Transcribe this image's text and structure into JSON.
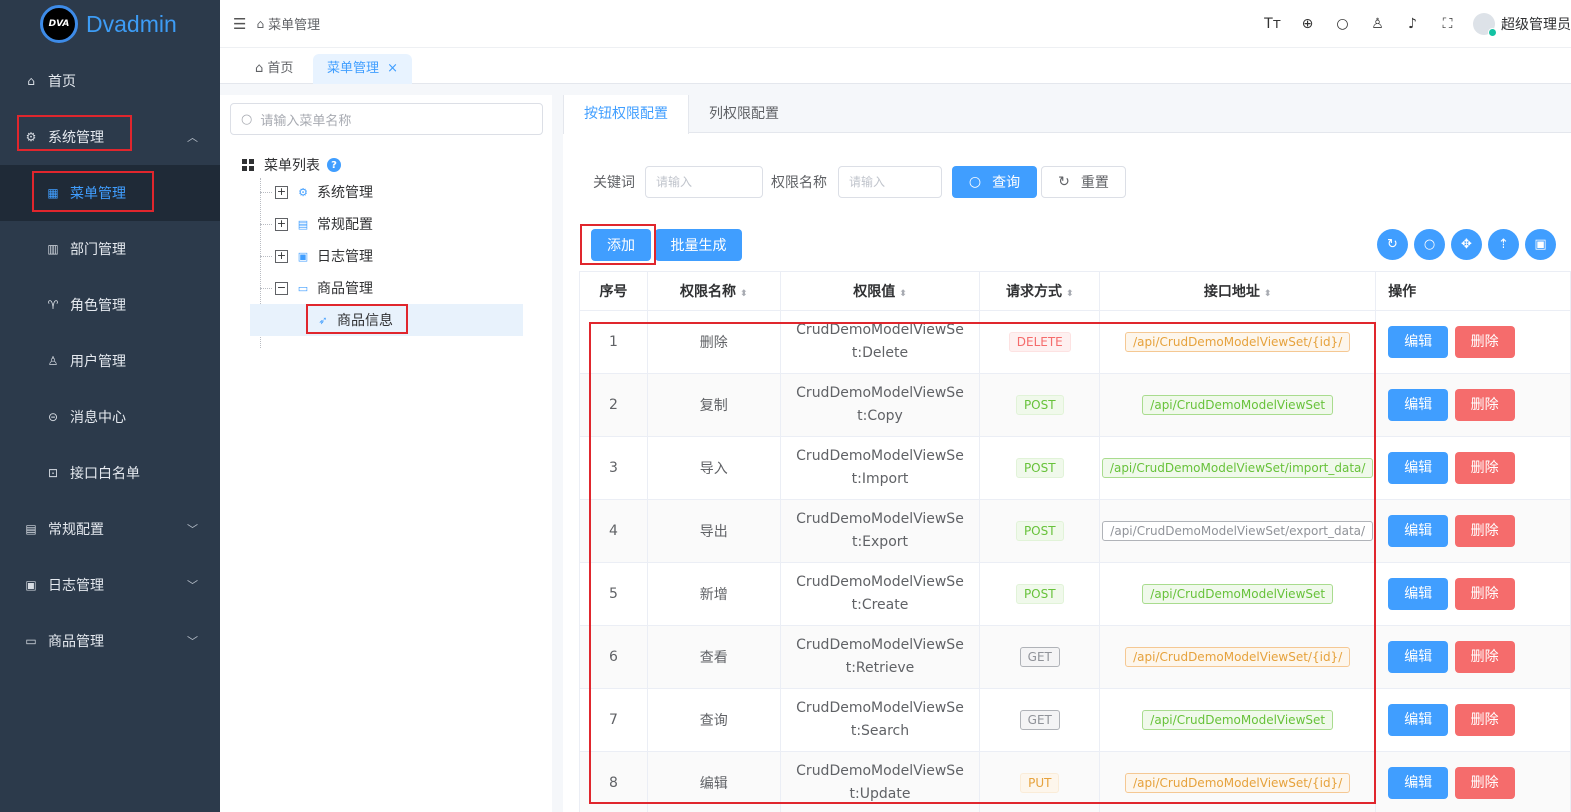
{
  "app": {
    "logo_badge": "DVA",
    "name": "Dvadmin"
  },
  "sidebar": {
    "items": [
      {
        "label": "首页",
        "icon": "home-icon"
      },
      {
        "label": "系统管理",
        "icon": "gear-icon",
        "expanded": true
      },
      {
        "label": "菜单管理",
        "icon": "grid-icon",
        "active": true
      },
      {
        "label": "部门管理",
        "icon": "building-icon"
      },
      {
        "label": "角色管理",
        "icon": "role-icon"
      },
      {
        "label": "用户管理",
        "icon": "user-icon"
      },
      {
        "label": "消息中心",
        "icon": "message-icon"
      },
      {
        "label": "接口白名单",
        "icon": "whitelist-icon"
      },
      {
        "label": "常规配置",
        "icon": "config-icon"
      },
      {
        "label": "日志管理",
        "icon": "log-icon"
      },
      {
        "label": "商品管理",
        "icon": "goods-icon"
      }
    ]
  },
  "header": {
    "breadcrumb": "菜单管理",
    "user": "超级管理员"
  },
  "tabs": [
    {
      "label": "首页"
    },
    {
      "label": "菜单管理"
    }
  ],
  "tree": {
    "search_placeholder": "请输入菜单名称",
    "root": "菜单列表",
    "help": "?",
    "nodes": [
      {
        "label": "系统管理",
        "state": "+"
      },
      {
        "label": "常规配置",
        "state": "+"
      },
      {
        "label": "日志管理",
        "state": "+"
      },
      {
        "label": "商品管理",
        "state": "−"
      }
    ],
    "leaf": "商品信息"
  },
  "panel": {
    "tabs": [
      {
        "label": "按钮权限配置"
      },
      {
        "label": "列权限配置"
      }
    ],
    "filter": {
      "keyword_label": "关键词",
      "keyword_placeholder": "请输入",
      "name_label": "权限名称",
      "name_placeholder": "请输入",
      "query": "查询",
      "reset": "重置"
    },
    "add": "添加",
    "batch": "批量生成"
  },
  "table": {
    "headers": {
      "no": "序号",
      "name": "权限名称",
      "value": "权限值",
      "method": "请求方式",
      "api": "接口地址",
      "ops": "操作"
    },
    "edit": "编辑",
    "delete": "删除",
    "rows": [
      {
        "no": "1",
        "name": "删除",
        "value": "CrudDemoModelViewSet:Delete",
        "method": "DELETE",
        "method_style": "danger",
        "api": "/api/CrudDemoModelViewSet/{id}/",
        "api_style": "warning"
      },
      {
        "no": "2",
        "name": "复制",
        "value": "CrudDemoModelViewSet:Copy",
        "method": "POST",
        "method_style": "success",
        "api": "/api/CrudDemoModelViewSet",
        "api_style": "success"
      },
      {
        "no": "3",
        "name": "导入",
        "value": "CrudDemoModelViewSet:Import",
        "method": "POST",
        "method_style": "success",
        "api": "/api/CrudDemoModelViewSet/import_data/",
        "api_style": "success"
      },
      {
        "no": "4",
        "name": "导出",
        "value": "CrudDemoModelViewSet:Export",
        "method": "POST",
        "method_style": "success",
        "api": "/api/CrudDemoModelViewSet/export_data/",
        "api_style": "info"
      },
      {
        "no": "5",
        "name": "新增",
        "value": "CrudDemoModelViewSet:Create",
        "method": "POST",
        "method_style": "success",
        "api": "/api/CrudDemoModelViewSet",
        "api_style": "success"
      },
      {
        "no": "6",
        "name": "查看",
        "value": "CrudDemoModelViewSet:Retrieve",
        "method": "GET",
        "method_style": "info",
        "api": "/api/CrudDemoModelViewSet/{id}/",
        "api_style": "warning"
      },
      {
        "no": "7",
        "name": "查询",
        "value": "CrudDemoModelViewSet:Search",
        "method": "GET",
        "method_style": "info",
        "api": "/api/CrudDemoModelViewSet",
        "api_style": "success"
      },
      {
        "no": "8",
        "name": "编辑",
        "value": "CrudDemoModelViewSet:Update",
        "method": "PUT",
        "method_style": "warning",
        "api": "/api/CrudDemoModelViewSet/{id}/",
        "api_style": "warning"
      }
    ]
  },
  "colors": {
    "primary": "#409eff",
    "sidebar": "#2c3a4b",
    "danger": "#f56c6c",
    "highlight": "#e0262d"
  }
}
